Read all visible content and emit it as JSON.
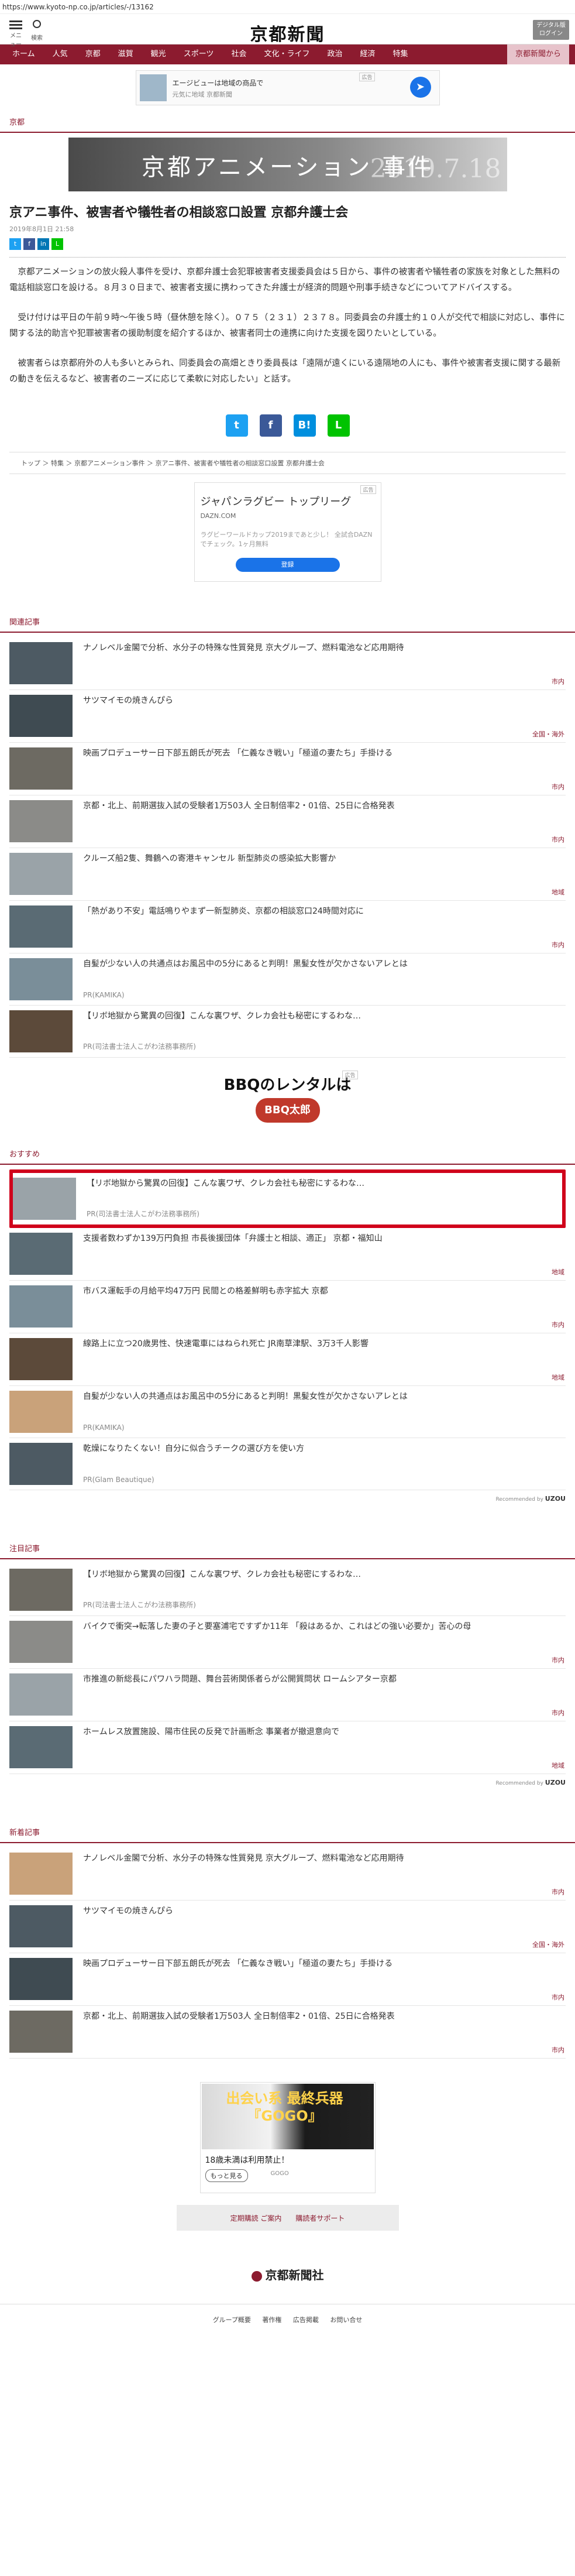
{
  "url": "https://www.kyoto-np.co.jp/articles/-/13162",
  "header": {
    "menu_label": "メニュー",
    "search_label": "検索",
    "logo": "京都新聞",
    "digital_label": "デジタル版 ログイン"
  },
  "nav": [
    "ホーム",
    "人気",
    "京都",
    "滋賀",
    "観光",
    "スポーツ",
    "社会",
    "文化・ライフ",
    "政治",
    "経済",
    "特集"
  ],
  "nav_special": "京都新聞から",
  "ad_top": {
    "line1": "エージビューは地域の商品で",
    "line2": "元気に地域 京都新聞",
    "badge": "広告"
  },
  "section": "京都",
  "banner": {
    "title": "京都アニメーション 事件",
    "date": "2019.7.18"
  },
  "article": {
    "headline": "京アニ事件、被害者や犠牲者の相談窓口設置 京都弁護士会",
    "date": "2019年8月1日 21:58",
    "p1": "京都アニメーションの放火殺人事件を受け、京都弁護士会犯罪被害者支援委員会は５日から、事件の被害者や犠牲者の家族を対象とした無料の電話相談窓口を設ける。８月３０日まで、被害者支援に携わってきた弁護士が経済的問題や刑事手続きなどについてアドバイスする。",
    "p2": "受け付けは平日の午前９時～午後５時（昼休憩を除く）。０７５（２３１）２３７８。同委員会の弁護士約１０人が交代で相談に対応し、事件に関する法的助言や犯罪被害者の援助制度を紹介するほか、被害者同士の連携に向けた支援を図りたいとしている。",
    "p3": "被害者らは京都府外の人も多いとみられ、同委員会の高畑ときり委員長は「遠隔が遠くにいる遠隔地の人にも、事件や被害者支援に関する最新の動きを伝えるなど、被害者のニーズに応じて柔軟に対応したい」と話す。"
  },
  "breadcrumb": "トップ ＞ 特集 ＞ 京都アニメーション事件 ＞ 京アニ事件、被害者や犠牲者の相談窓口設置 京都弁護士会",
  "ad_mid": {
    "badge": "広告",
    "title": "ジャパンラグビー トップリーグ",
    "sub": "DAZN.COM",
    "desc": "ラグビーワールドカップ2019まであと少し！ 全試合DAZNでチェック。1ヶ月無料",
    "button": "登録"
  },
  "related": {
    "label": "関連記事",
    "items": [
      {
        "title": "ナノレベル金閣で分析、水分子の特殊な性質発見 京大グループ、燃料電池など応用期待",
        "tag": "市内"
      },
      {
        "title": "サツマイモの焼きんぴら",
        "tag": "全国・海外"
      },
      {
        "title": "映画プロデューサー日下部五朗氏が死去 「仁義なき戦い」「極道の妻たち」手掛ける",
        "tag": "市内"
      },
      {
        "title": "京都・北上、前期選抜入試の受験者1万503人 全日制倍率2・01倍、25日に合格発表",
        "tag": "市内"
      },
      {
        "title": "クルーズ船2隻、舞鶴への寄港キャンセル 新型肺炎の感染拡大影響か",
        "tag": "地域"
      },
      {
        "title": "「熱があり不安」電話鳴りやまず一新型肺炎、京都の相談窓口24時間対応に",
        "tag": "市内"
      },
      {
        "title": "自髪が少ない人の共通点はお風呂中の5分にあると判明！黒髪女性が欠かさないアレとは",
        "pr": "PR(KAMIKA)"
      },
      {
        "title": "【リボ地獄から驚異の回復】こんな裏ワザ、クレカ会社も秘密にするわな…",
        "pr": "PR(司法書士法人こがわ法務事務所)"
      }
    ]
  },
  "ad_bbq": {
    "title": "BBQのレンタルは",
    "logo": "BBQ太郎",
    "badge": "広告"
  },
  "recommended": {
    "label": "おすすめ",
    "by": "Recommended by",
    "brand": "UZOU",
    "items": [
      {
        "title": "【リボ地獄から驚異の回復】こんな裏ワザ、クレカ会社も秘密にするわな…",
        "pr": "PR(司法書士法人こがわ法務事務所)"
      },
      {
        "title": "支援者数わずか139万円負担 市長後援団体「弁護士と相談、適正」 京都・福知山",
        "tag": "地域"
      },
      {
        "title": "市バス運転手の月給平均47万円 民間との格差鮮明も赤字拡大 京都",
        "tag": "市内"
      },
      {
        "title": "線路上に立つ20歳男性、快速電車にはねられ死亡 JR南草津駅、3万3千人影響",
        "tag": "地域"
      },
      {
        "title": "自髪が少ない人の共通点はお風呂中の5分にあると判明！黒髪女性が欠かさないアレとは",
        "pr": "PR(KAMIKA)"
      },
      {
        "title": "乾燥になりたくない！自分に似合うチークの選び方を使い方",
        "pr": "PR(Glam Beautique)"
      }
    ]
  },
  "attention": {
    "label": "注目記事",
    "items": [
      {
        "title": "【リボ地獄から驚異の回復】こんな裏ワザ、クレカ会社も秘密にするわな…",
        "pr": "PR(司法書士法人こがわ法務事務所)"
      },
      {
        "title": "バイクで衝突→転落した妻の子と要塞浦宅ですずか11年 「殺はあるか、これはどの強い必要か」苦心の母",
        "tag": "市内"
      },
      {
        "title": "市推進の新総長にパワハラ問題、舞台芸術関係者らが公開質問状 ロームシアター京都",
        "tag": "市内"
      },
      {
        "title": "ホームレス放置施設、陽市住民の反発で計画断念 事業者が撤退意向で",
        "tag": "地域"
      }
    ]
  },
  "newest": {
    "label": "新着記事",
    "items": [
      {
        "title": "ナノレベル金閣で分析、水分子の特殊な性質発見 京大グループ、燃料電池など応用期待",
        "tag": "市内"
      },
      {
        "title": "サツマイモの焼きんぴら",
        "tag": "全国・海外"
      },
      {
        "title": "映画プロデューサー日下部五朗氏が死去 「仁義なき戦い」「極道の妻たち」手掛ける",
        "tag": "市内"
      },
      {
        "title": "京都・北上、前期選抜入試の受験者1万503人 全日制倍率2・01倍、25日に合格発表",
        "tag": "市内"
      }
    ]
  },
  "ad_bottom": {
    "banner_text": "出会い系 最終兵器 『GOGO』",
    "caption": "18歳未満は利用禁止！",
    "more": "もっと見る",
    "sub": "GOGO"
  },
  "footer": {
    "links": [
      "定期購読 ご案内",
      "購読者サポート"
    ],
    "logo": "京都新聞社",
    "nav": [
      "グループ概要",
      "著作権",
      "広告掲載",
      "お問い合せ"
    ]
  }
}
